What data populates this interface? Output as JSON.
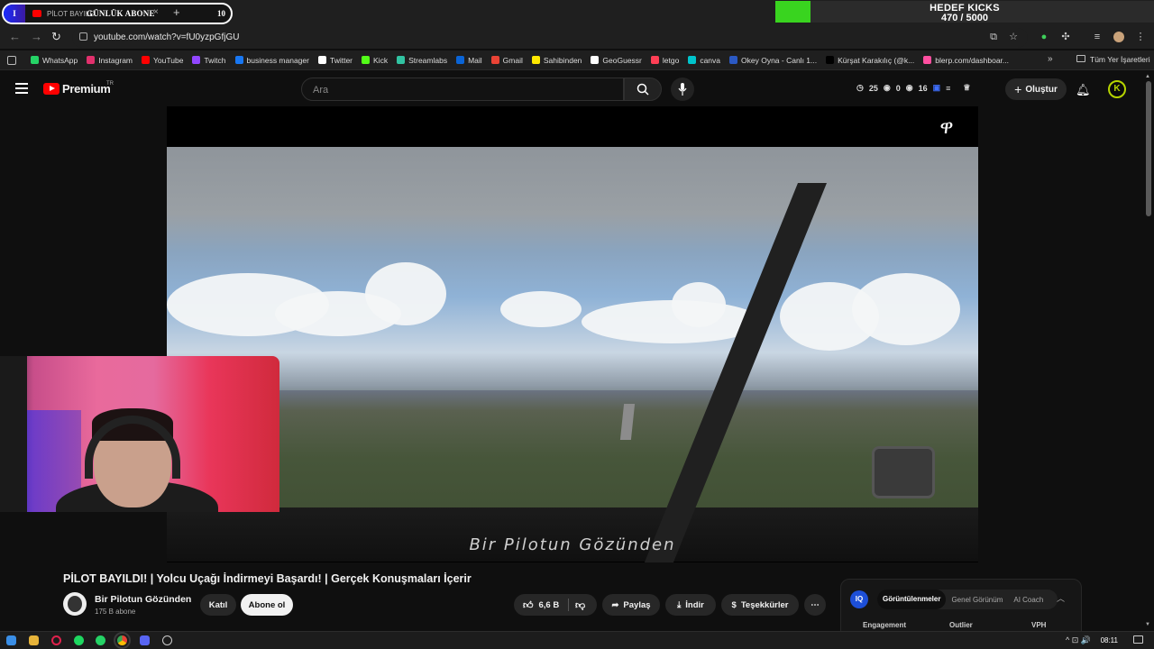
{
  "tabstrip": {
    "overlay_left_label": "I",
    "tab_title": "PİLOT BAYILD",
    "overlay_title": "GÜNLÜK ABONE",
    "close_glyph": "×",
    "newtab_glyph": "+",
    "overlay_count": "10"
  },
  "goal": {
    "title": "HEDEF KICKS",
    "count": "470 / 5000",
    "progress": 0.094,
    "bar_color": "#39d41f"
  },
  "browser": {
    "url": "youtube.com/watch?v=fU0yzpGfjGU",
    "back_glyph": "←",
    "forward_glyph": "→",
    "reload_glyph": "↻"
  },
  "bookmarks": {
    "items": [
      {
        "label": "WhatsApp",
        "color": "#25d366"
      },
      {
        "label": "Instagram",
        "color": "#e1306c"
      },
      {
        "label": "YouTube",
        "color": "#ff0000"
      },
      {
        "label": "Twitch",
        "color": "#9146ff"
      },
      {
        "label": "business manager",
        "color": "#1877f2"
      },
      {
        "label": "Twitter",
        "color": "#ffffff"
      },
      {
        "label": "Kick",
        "color": "#53fc18"
      },
      {
        "label": "Streamlabs",
        "color": "#31c3a2"
      },
      {
        "label": "Mail",
        "color": "#0a64d6"
      },
      {
        "label": "Gmail",
        "color": "#ea4335"
      },
      {
        "label": "Sahibinden",
        "color": "#ffe800"
      },
      {
        "label": "GeoGuessr",
        "color": "#ffffff"
      },
      {
        "label": "letgo",
        "color": "#ff3f55"
      },
      {
        "label": "canva",
        "color": "#00c4cc"
      },
      {
        "label": "Okey Oyna - Canlı 1...",
        "color": "#2b59c3"
      },
      {
        "label": "Kürşat Karakılıç (@k...",
        "color": "#000000"
      },
      {
        "label": "blerp.com/dashboar...",
        "color": "#ff4fa0"
      }
    ],
    "overflow_glyph": "»",
    "all_bookmarks": "Tüm Yer İşaretleri"
  },
  "yt_header": {
    "logo_text": "Premium",
    "logo_region": "TR",
    "search_placeholder": "Ara",
    "stats": [
      "25",
      "0",
      "16"
    ],
    "create_label": "Oluştur",
    "avatar_letter": "K"
  },
  "video": {
    "subtitle": "Bir Pilotun Gözünden",
    "title": "PİLOT BAYILDI! | Yolcu Uçağı İndirmeyi Başardı! | Gerçek Konuşmaları İçerir"
  },
  "channel": {
    "name": "Bir Pilotun Gözünden",
    "subs": "175 B abone",
    "join_label": "Katıl",
    "subscribe_label": "Abone ol"
  },
  "actions": {
    "likes": "6,6 B",
    "share": "Paylaş",
    "download": "İndir",
    "thanks": "Teşekkürler",
    "more": "⋯"
  },
  "extension": {
    "logo": "IQ",
    "tabs": [
      "Görüntülenmeler",
      "Genel Görünüm",
      "AI Coach"
    ],
    "columns": [
      "Engagement",
      "Outlier",
      "VPH"
    ]
  },
  "taskbar": {
    "time": "08:11",
    "tray": "^ ⊡ 🔊"
  }
}
